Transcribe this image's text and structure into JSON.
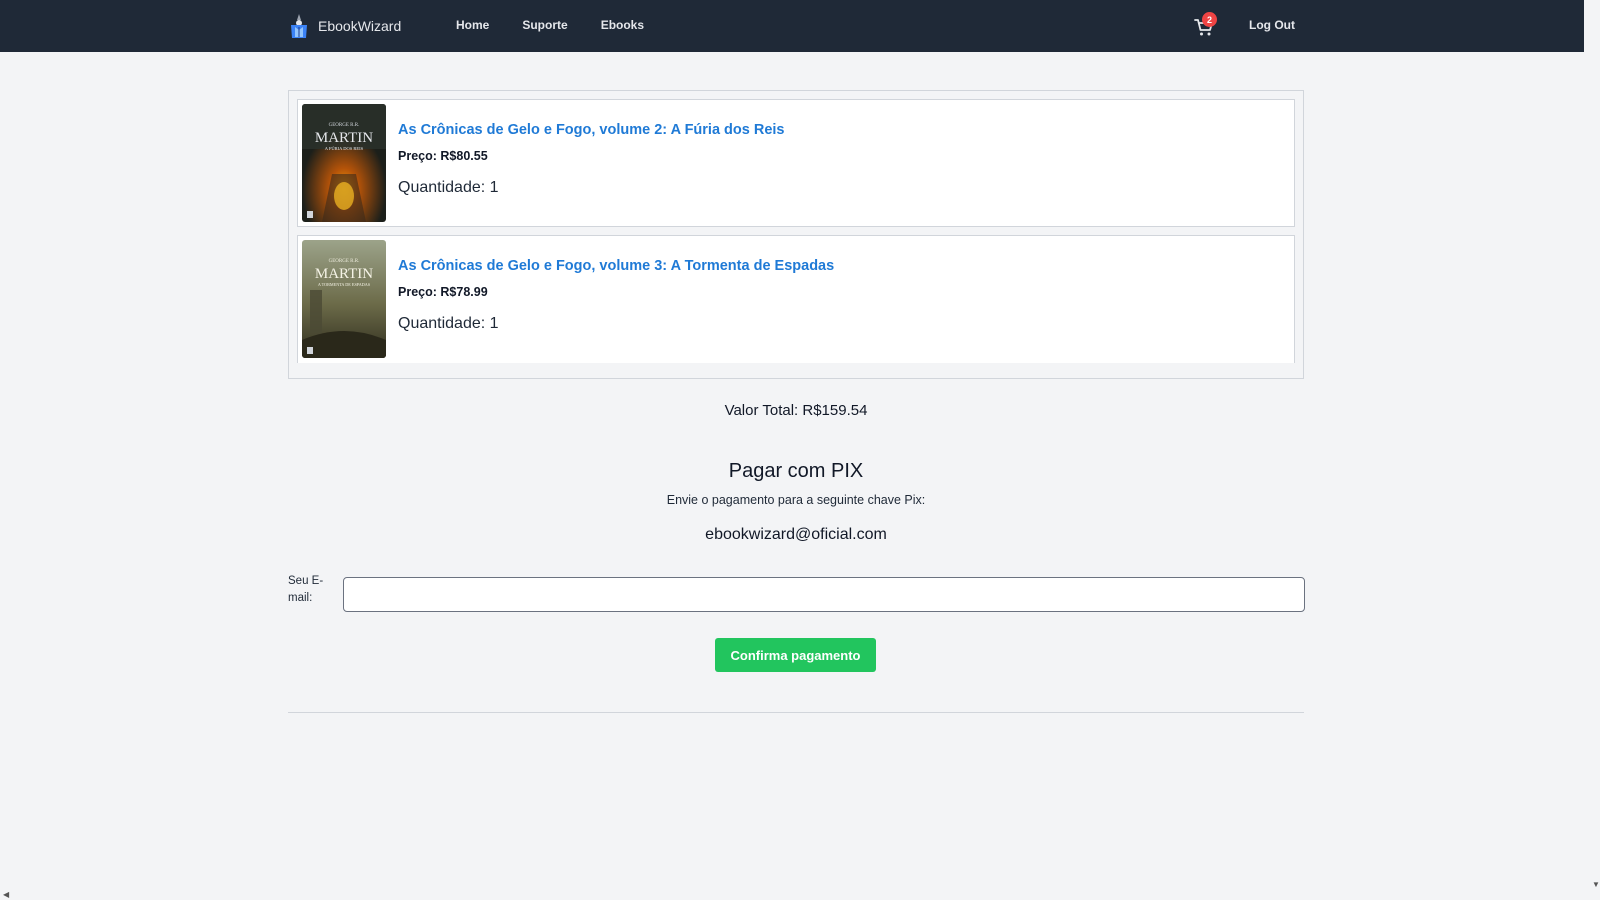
{
  "navbar": {
    "brand": "EbookWizard",
    "links": [
      "Home",
      "Suporte",
      "Ebooks"
    ],
    "cart_count": "2",
    "logout": "Log Out",
    "icons": {
      "logo": "wizard-logo-icon",
      "cart": "shopping-cart-icon"
    },
    "colors": {
      "background": "#1f2937",
      "badge": "#ef4444"
    }
  },
  "cart": {
    "items": [
      {
        "title": "As Crônicas de Gelo e Fogo, volume 2: A Fúria dos Reis",
        "price_label": "Preço:",
        "price": "R$80.55",
        "quantity": "Quantidade: 1",
        "cover": {
          "author": "MARTIN",
          "small_top": "GEORGE R.R.",
          "subtitle": "A FÚRIA DOS REIS"
        }
      },
      {
        "title": "As Crônicas de Gelo e Fogo, volume 3: A Tormenta de Espadas",
        "price_label": "Preço:",
        "price": "R$78.99",
        "quantity": "Quantidade: 1",
        "cover": {
          "author": "MARTIN",
          "small_top": "GEORGE R.R.",
          "subtitle": "A TORMENTA DE ESPADAS"
        }
      }
    ],
    "colors": {
      "title_link": "#1f7ad6"
    }
  },
  "summary": {
    "total": "Valor Total: R$159.54"
  },
  "pix": {
    "heading": "Pagar com PIX",
    "instruction": "Envie o pagamento para a seguinte chave Pix:",
    "key": "ebookwizard@oficial.com"
  },
  "form": {
    "email_label": "Seu E-mail:",
    "email_value": "",
    "email_placeholder": "",
    "confirm_button": "Confirma pagamento",
    "colors": {
      "confirm_button": "#22c55e"
    }
  }
}
